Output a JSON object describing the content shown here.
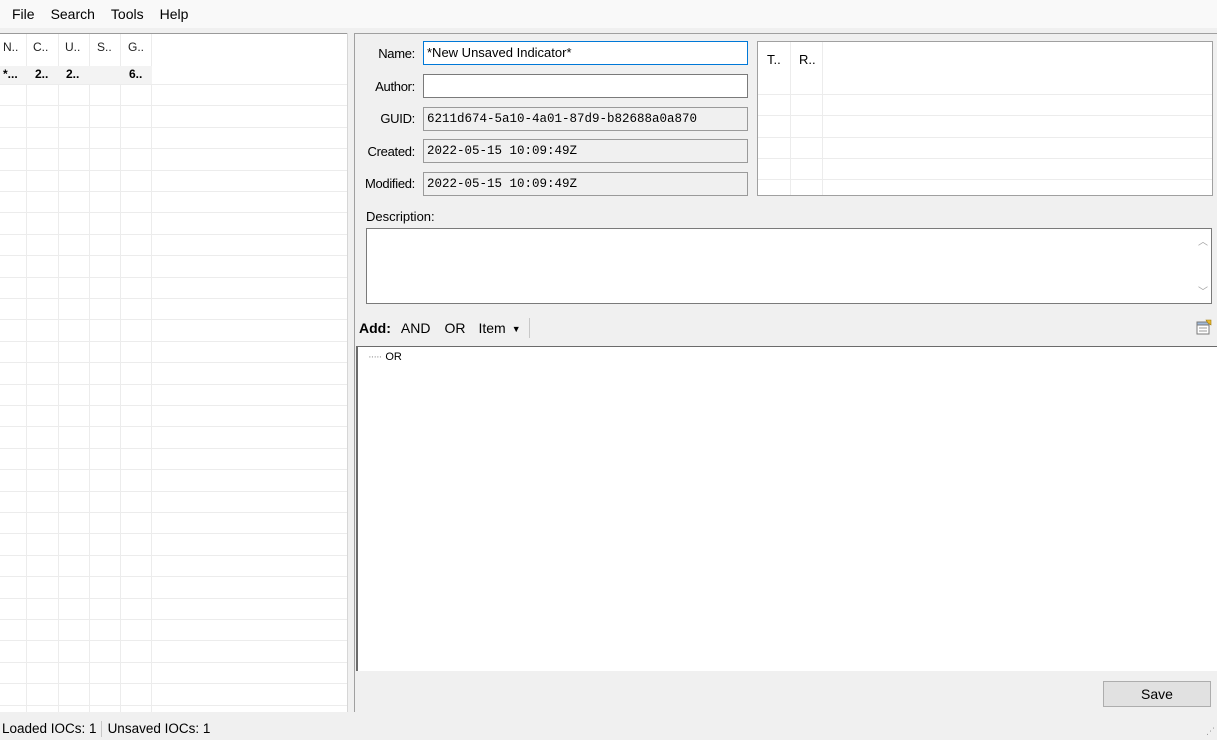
{
  "menu": {
    "file": "File",
    "search": "Search",
    "tools": "Tools",
    "help": "Help"
  },
  "list": {
    "columns": [
      "N..",
      "C..",
      "U..",
      "S..",
      "G.."
    ],
    "rows": [
      {
        "n": "*...",
        "c": "2..",
        "u": "2..",
        "s": "",
        "g": "6.."
      }
    ]
  },
  "form": {
    "name_label": "Name:",
    "name_value": "*New Unsaved Indicator*",
    "author_label": "Author:",
    "author_value": "",
    "guid_label": "GUID:",
    "guid_value": "6211d674-5a10-4a01-87d9-b82688a0a870",
    "created_label": "Created:",
    "created_value": "2022-05-15 10:09:49Z",
    "modified_label": "Modified:",
    "modified_value": "2022-05-15 10:09:49Z",
    "description_label": "Description:",
    "description_value": ""
  },
  "params": {
    "columns": [
      "T..",
      "R.."
    ]
  },
  "toolbar": {
    "add_label": "Add:",
    "and_label": "AND",
    "or_label": "OR",
    "item_label": "Item",
    "properties_icon": "properties-icon"
  },
  "tree": {
    "root_label": "OR"
  },
  "buttons": {
    "save_label": "Save"
  },
  "status": {
    "loaded": "Loaded IOCs: 1",
    "unsaved": "Unsaved IOCs: 1"
  },
  "colors": {
    "focus_border": "#0078d7",
    "panel_bg": "#f0f0f0"
  }
}
